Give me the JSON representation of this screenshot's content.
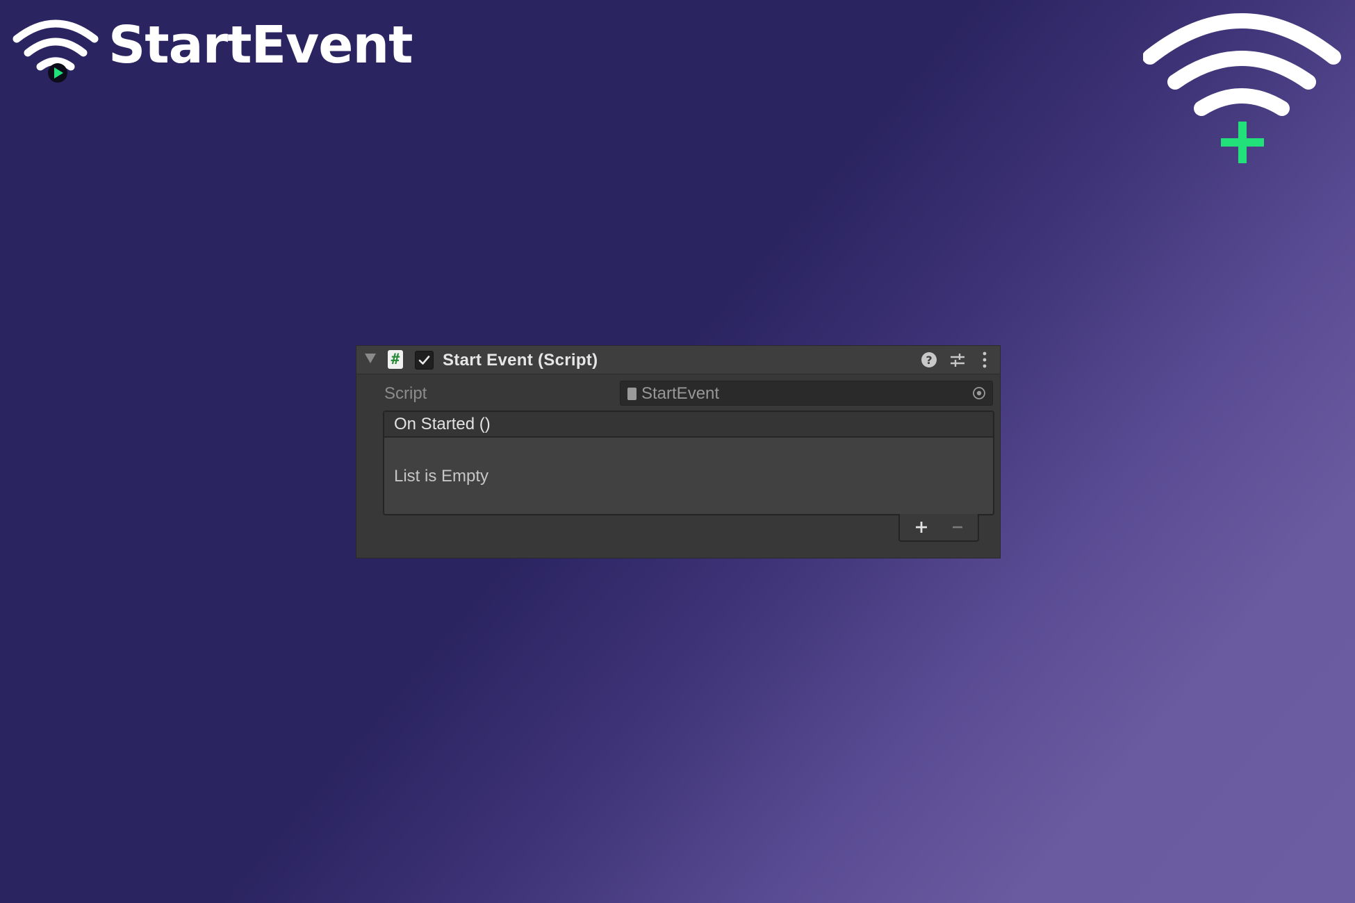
{
  "brand": {
    "title": "StartEvent",
    "icon": "wifi-play-icon",
    "play_color": "#22e07a"
  },
  "corner": {
    "icon": "wifi-add-icon",
    "plus_color": "#22e07a"
  },
  "inspector": {
    "component_title": "Start Event (Script)",
    "enabled": true,
    "header_icons": [
      "foldout-arrow-icon",
      "csharp-script-icon",
      "checkbox-icon",
      "help-icon",
      "presets-icon",
      "kebab-menu-icon"
    ],
    "script_field": {
      "label": "Script",
      "value": "StartEvent",
      "icon": "script-file-icon",
      "picker_icon": "object-picker-icon"
    },
    "event": {
      "title": "On Started ()",
      "empty_text": "List is Empty",
      "add_icon": "plus-icon",
      "remove_icon": "minus-icon"
    }
  }
}
